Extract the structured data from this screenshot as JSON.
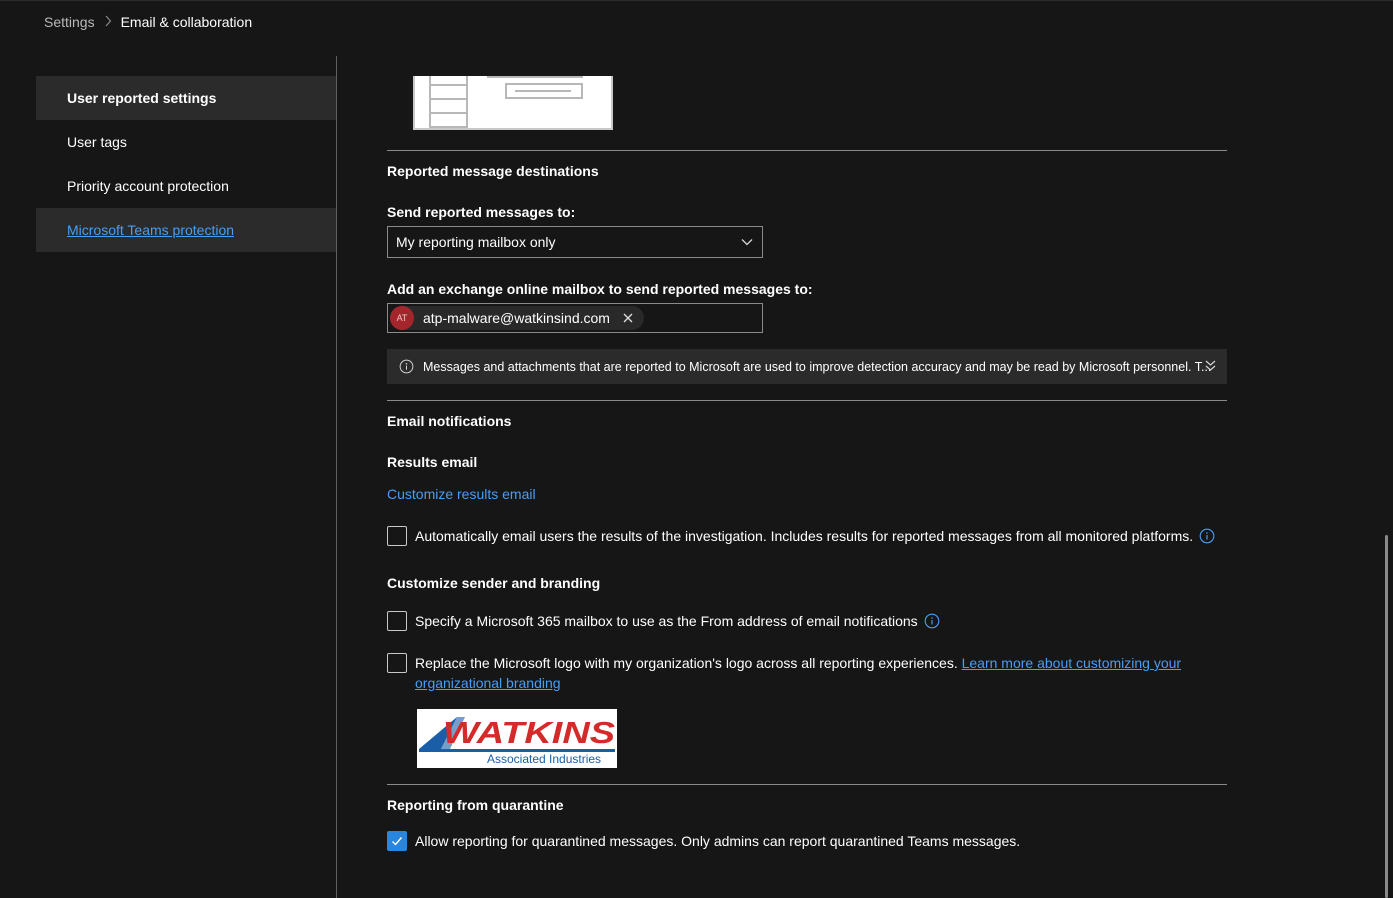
{
  "breadcrumb": {
    "root": "Settings",
    "current": "Email & collaboration"
  },
  "sidebar": {
    "items": [
      {
        "label": "User reported settings"
      },
      {
        "label": "User tags"
      },
      {
        "label": "Priority account protection"
      },
      {
        "label": "Microsoft Teams protection"
      }
    ]
  },
  "destinations": {
    "title": "Reported message destinations",
    "send_label": "Send reported messages to:",
    "send_value": "My reporting mailbox only",
    "mailbox_label": "Add an exchange online mailbox to send reported messages to:",
    "mailbox_avatar": "AT",
    "mailbox_value": "atp-malware@watkinsind.com",
    "info_text": "Messages and attachments that are reported to Microsoft are used to improve detection accuracy and may be read by Microsoft personnel. T..."
  },
  "notifications": {
    "title": "Email notifications",
    "results_label": "Results email",
    "customize_link": "Customize results email",
    "auto_email_label": "Automatically email users the results of the investigation. Includes results for reported messages from all monitored platforms.",
    "auto_email_checked": false,
    "branding_title": "Customize sender and branding",
    "specify_label": "Specify a Microsoft 365 mailbox to use as the From address of email notifications",
    "specify_checked": false,
    "replace_label": "Replace the Microsoft logo with my organization's logo across all reporting experiences.",
    "replace_link": "Learn more about customizing your organizational branding",
    "replace_checked": false,
    "logo_name": "WATKINS",
    "logo_sub": "Associated Industries"
  },
  "quarantine": {
    "title": "Reporting from quarantine",
    "allow_label": "Allow reporting for quarantined messages. Only admins can report quarantined Teams messages.",
    "allow_checked": true
  },
  "colors": {
    "background": "#161616",
    "accent": "#2886de",
    "link": "#479ef5",
    "avatar": "#a4262c"
  }
}
